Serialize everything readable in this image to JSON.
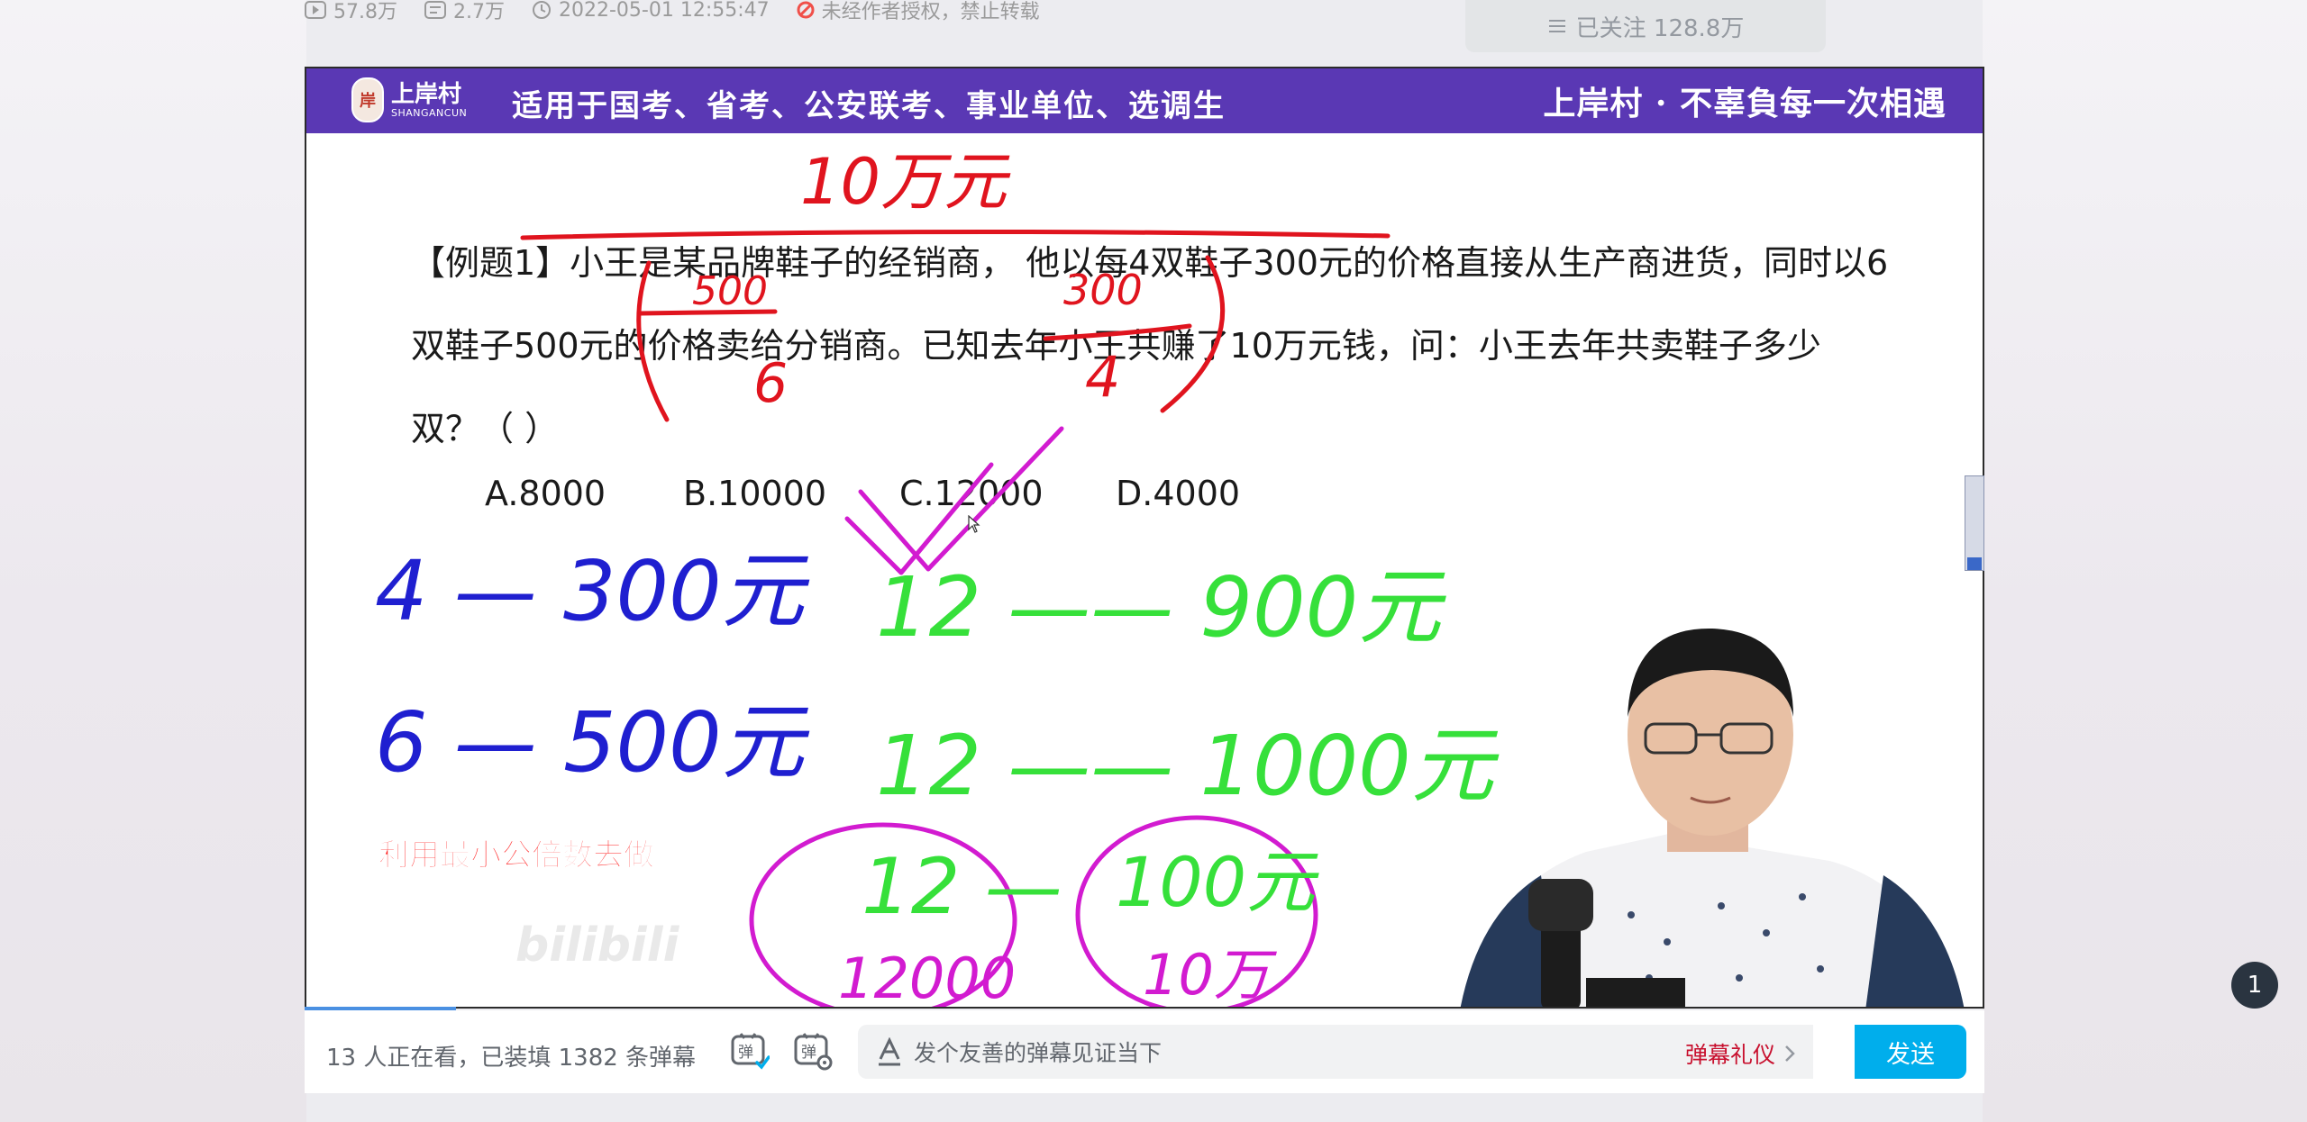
{
  "meta": {
    "play_count": "57.8万",
    "danmaku_count": "2.7万",
    "publish_time": "2022-05-01 12:55:47",
    "copyright_notice": "未经作者授权，禁止转载"
  },
  "follow_button": {
    "label": "已关注 128.8万"
  },
  "slide": {
    "logo_cn": "上岸村",
    "logo_en": "SHANGANCUN",
    "slogan": "适用于国考、省考、公安联考、事业单位、选调生",
    "header_right": "上岸村 · 不辜負每一次相遇",
    "question": "【例题1】小王是某品牌鞋子的经销商，   他以每4双鞋子300元的价格直接从生产商进货，同时以6双鞋子500元的价格卖给分销商。已知去年小王共赚了10万元钱，问：小王去年共卖鞋子多少双？（ ）",
    "options": [
      "A.8000",
      "B.10000",
      "C.12000",
      "D.4000"
    ],
    "hint": "利用最小公倍数去做",
    "watermark": "bilibili"
  },
  "annotations": {
    "top": "10万元",
    "frac_left_num": "500",
    "frac_left_den": "6",
    "frac_right_num": "300",
    "frac_right_den": "4",
    "blue_line1": "4 — 300元",
    "blue_line2": "6 — 500元",
    "green_line1": "12 —— 900元",
    "green_line2": "12 —— 1000元",
    "green_line3": "12 —",
    "green_line3_right": "100元",
    "circle_left_bottom": "12000",
    "circle_right_bottom": "10万"
  },
  "bottom_bar": {
    "viewers_text": "13 人正在看，已装填 1382 条弹幕",
    "danmaku_placeholder": "发个友善的弹幕见证当下",
    "etiquette_label": "弹幕礼仪",
    "send_label": "发送"
  },
  "page_badge": "1",
  "colors": {
    "header_purple": "#5a38b4",
    "send_blue": "#00aeec",
    "ink_red": "#e0141e",
    "ink_blue": "#1f1fd0",
    "ink_green": "#36e03a",
    "ink_magenta": "#d21bd0"
  }
}
